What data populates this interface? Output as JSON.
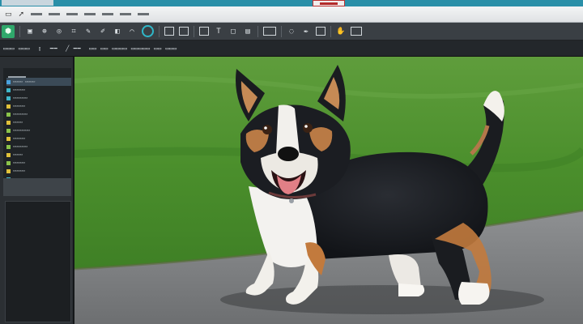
{
  "menubar": {
    "icons": [
      "window-icon",
      "arrow-icon",
      "file-icon",
      "edit-icon",
      "view-icon"
    ]
  },
  "toolbar": {
    "tools": [
      {
        "name": "new-layer-tool",
        "glyph": "▣"
      },
      {
        "name": "move-tool",
        "glyph": "⊕"
      },
      {
        "name": "zoom-tool",
        "glyph": "◎"
      },
      {
        "name": "crop-tool",
        "glyph": "⌗"
      },
      {
        "name": "eraser-tool",
        "glyph": "✎"
      },
      {
        "name": "brush-tool",
        "glyph": "✐"
      },
      {
        "name": "fill-tool",
        "glyph": "◧"
      },
      {
        "name": "lasso-tool",
        "glyph": "⌒"
      },
      {
        "name": "text-tool",
        "glyph": "T"
      },
      {
        "name": "shape-tool",
        "glyph": "□"
      },
      {
        "name": "gradient-tool",
        "glyph": "▤"
      },
      {
        "name": "blur-tool",
        "glyph": "◌"
      },
      {
        "name": "pen-tool",
        "glyph": "✒"
      },
      {
        "name": "hand-tool",
        "glyph": "✋"
      }
    ]
  },
  "colors": {
    "titlebar": "#2a8fa8",
    "accent_green": "#2fa86b",
    "accent_teal": "#2fb7c9",
    "panel_bg": "#2b2f33"
  }
}
